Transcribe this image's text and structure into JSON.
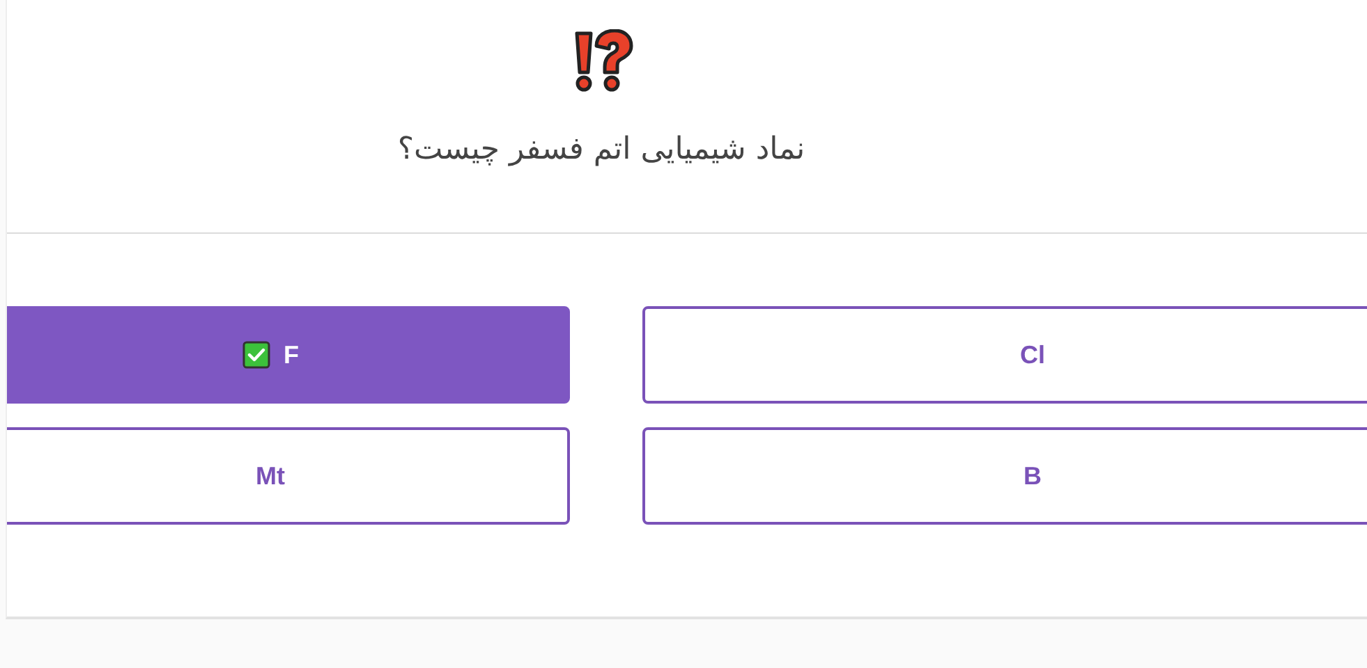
{
  "question": {
    "text": "نماد شیمیایی اتم فسفر چیست؟"
  },
  "options": [
    {
      "label": "Cl",
      "selected": false,
      "correct": false
    },
    {
      "label": "F",
      "selected": true,
      "correct": true
    },
    {
      "label": "B",
      "selected": false,
      "correct": false
    },
    {
      "label": "Mt",
      "selected": false,
      "correct": false
    }
  ]
}
